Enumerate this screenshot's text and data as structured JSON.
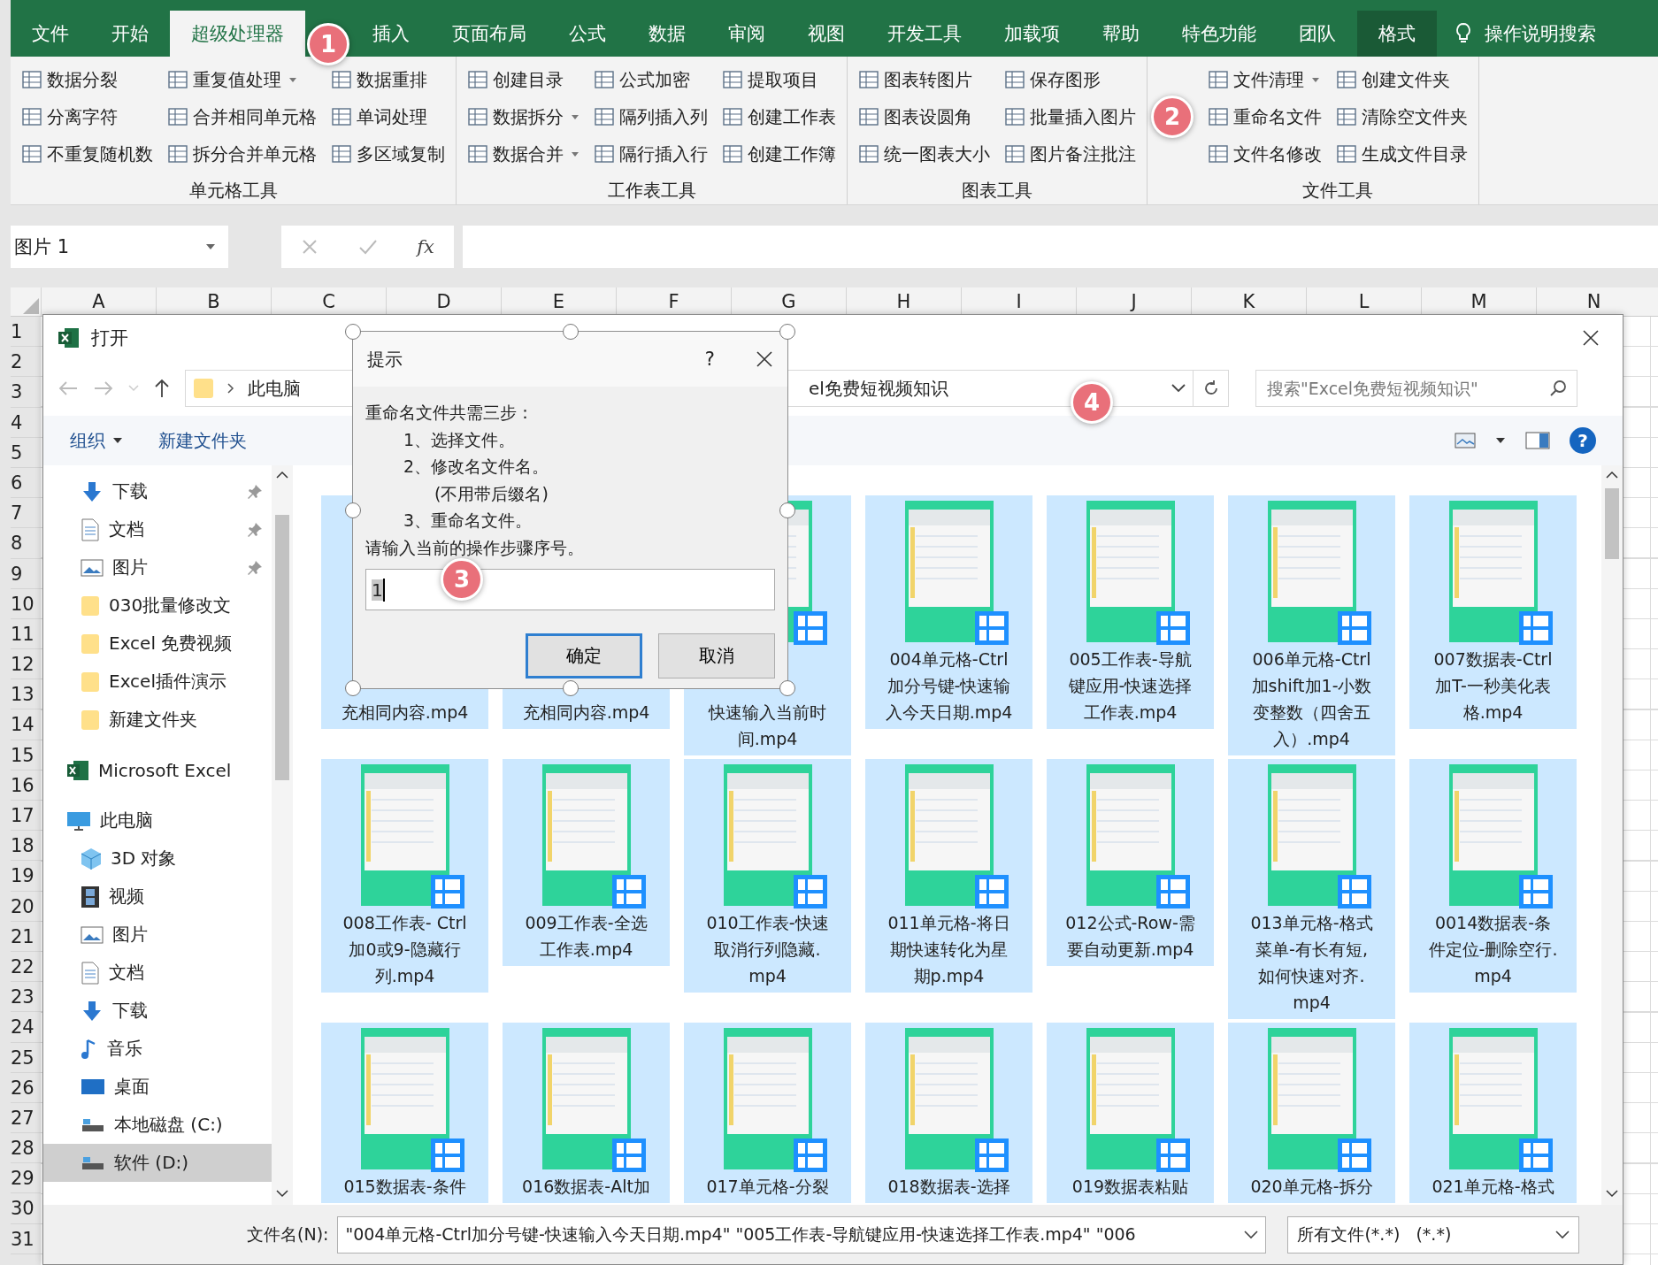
{
  "ribbon": {
    "tabs": [
      {
        "label": "文件",
        "selected": false,
        "kind": "normal"
      },
      {
        "label": "开始",
        "selected": false,
        "kind": "normal"
      },
      {
        "label": "超级处理器",
        "selected": true,
        "kind": "normal"
      },
      {
        "label": "插入",
        "selected": false,
        "kind": "normal"
      },
      {
        "label": "页面布局",
        "selected": false,
        "kind": "normal"
      },
      {
        "label": "公式",
        "selected": false,
        "kind": "normal"
      },
      {
        "label": "数据",
        "selected": false,
        "kind": "normal"
      },
      {
        "label": "审阅",
        "selected": false,
        "kind": "normal"
      },
      {
        "label": "视图",
        "selected": false,
        "kind": "normal"
      },
      {
        "label": "开发工具",
        "selected": false,
        "kind": "normal"
      },
      {
        "label": "加载项",
        "selected": false,
        "kind": "normal"
      },
      {
        "label": "帮助",
        "selected": false,
        "kind": "normal"
      },
      {
        "label": "特色功能",
        "selected": false,
        "kind": "normal"
      },
      {
        "label": "团队",
        "selected": false,
        "kind": "normal"
      },
      {
        "label": "格式",
        "selected": false,
        "kind": "context"
      }
    ],
    "tell_me": "操作说明搜索",
    "groups": [
      {
        "label": "单元格工具",
        "columns": [
          [
            {
              "label": "数据分裂",
              "dropdown": false
            },
            {
              "label": "分离字符",
              "dropdown": false
            },
            {
              "label": "不重复随机数",
              "dropdown": false
            }
          ],
          [
            {
              "label": "重复值处理",
              "dropdown": true
            },
            {
              "label": "合并相同单元格",
              "dropdown": false
            },
            {
              "label": "拆分合并单元格",
              "dropdown": false
            }
          ],
          [
            {
              "label": "数据重排",
              "dropdown": false
            },
            {
              "label": "单词处理",
              "dropdown": false
            },
            {
              "label": "多区域复制",
              "dropdown": false
            }
          ]
        ]
      },
      {
        "label": "工作表工具",
        "columns": [
          [
            {
              "label": "创建目录",
              "dropdown": false
            },
            {
              "label": "数据拆分",
              "dropdown": true
            },
            {
              "label": "数据合并",
              "dropdown": true
            }
          ],
          [
            {
              "label": "公式加密",
              "dropdown": false
            },
            {
              "label": "隔列插入列",
              "dropdown": false
            },
            {
              "label": "隔行插入行",
              "dropdown": false
            }
          ],
          [
            {
              "label": "提取项目",
              "dropdown": false
            },
            {
              "label": "创建工作表",
              "dropdown": false
            },
            {
              "label": "创建工作簿",
              "dropdown": false
            }
          ]
        ]
      },
      {
        "label": "图表工具",
        "columns": [
          [
            {
              "label": "图表转图片",
              "dropdown": false
            },
            {
              "label": "图表设圆角",
              "dropdown": false
            },
            {
              "label": "统一图表大小",
              "dropdown": false
            }
          ],
          [
            {
              "label": "保存图形",
              "dropdown": false
            },
            {
              "label": "批量插入图片",
              "dropdown": false
            },
            {
              "label": "图片备注批注",
              "dropdown": false
            }
          ]
        ]
      },
      {
        "label": "文件工具",
        "columns": [
          [
            {
              "label": "文件清理",
              "dropdown": true
            },
            {
              "label": "重命名文件",
              "dropdown": false
            },
            {
              "label": "文件名修改",
              "dropdown": false
            }
          ],
          [
            {
              "label": "创建文件夹",
              "dropdown": false
            },
            {
              "label": "清除空文件夹",
              "dropdown": false
            },
            {
              "label": "生成文件目录",
              "dropdown": false
            }
          ]
        ]
      }
    ]
  },
  "formula_bar": {
    "name_box": "图片 1",
    "function_label": "fx"
  },
  "sheet": {
    "columns": [
      "A",
      "B",
      "C",
      "D",
      "E",
      "F",
      "G",
      "H",
      "I",
      "J",
      "K",
      "L",
      "M",
      "N"
    ],
    "rows": [
      "1",
      "2",
      "3",
      "4",
      "5",
      "6",
      "7",
      "8",
      "9",
      "10",
      "11",
      "12",
      "13",
      "14",
      "15",
      "16",
      "17",
      "18",
      "19",
      "20",
      "21",
      "22",
      "23",
      "24",
      "25",
      "26",
      "27",
      "28",
      "29",
      "30",
      "31"
    ]
  },
  "open_dialog": {
    "title": "打开",
    "address": [
      "此电脑",
      "el免费短视频知识"
    ],
    "search": {
      "placeholder": "搜索\"Excel免费短视频知识\""
    },
    "organize": "组织",
    "new_folder": "新建文件夹",
    "help_label": "?",
    "quick_access": [
      {
        "label": "下载",
        "kind": "download",
        "pinned": true
      },
      {
        "label": "文档",
        "kind": "document",
        "pinned": true
      },
      {
        "label": "图片",
        "kind": "picture",
        "pinned": true
      },
      {
        "label": "030批量修改文",
        "kind": "folder",
        "pinned": false
      },
      {
        "label": "Excel 免费视频",
        "kind": "folder",
        "pinned": false
      },
      {
        "label": "Excel插件演示",
        "kind": "folder",
        "pinned": false
      },
      {
        "label": "新建文件夹",
        "kind": "folder",
        "pinned": false
      }
    ],
    "tree": [
      {
        "label": "Microsoft Excel",
        "kind": "excel",
        "selected": false
      },
      {
        "label": "此电脑",
        "kind": "pc",
        "selected": false,
        "children": [
          {
            "label": "3D 对象",
            "kind": "cube",
            "selected": false
          },
          {
            "label": "视频",
            "kind": "video",
            "selected": false
          },
          {
            "label": "图片",
            "kind": "picture",
            "selected": false
          },
          {
            "label": "文档",
            "kind": "document",
            "selected": false
          },
          {
            "label": "下载",
            "kind": "download",
            "selected": false
          },
          {
            "label": "音乐",
            "kind": "music",
            "selected": false
          },
          {
            "label": "桌面",
            "kind": "desktop",
            "selected": false
          },
          {
            "label": "本地磁盘 (C:)",
            "kind": "drive",
            "selected": false
          },
          {
            "label": "软件 (D:)",
            "kind": "drive",
            "selected": true
          }
        ]
      }
    ],
    "files": [
      {
        "lines": [
          "充相同内容.mp4"
        ],
        "selected": true,
        "covered": true
      },
      {
        "lines": [
          "充相同内容.mp4"
        ],
        "selected": true,
        "covered": true
      },
      {
        "lines": [
          "快速输入当前时",
          "间.mp4"
        ],
        "selected": true,
        "covered": true
      },
      {
        "lines": [
          "004单元格-Ctrl",
          "加分号键-快速输",
          "入今天日期.mp4"
        ],
        "selected": true,
        "covered": false
      },
      {
        "lines": [
          "005工作表-导航",
          "键应用-快速选择",
          "工作表.mp4"
        ],
        "selected": true,
        "covered": false
      },
      {
        "lines": [
          "006单元格-Ctrl",
          "加shift加1-小数",
          "变整数（四舍五",
          "入）.mp4"
        ],
        "selected": true,
        "covered": false
      },
      {
        "lines": [
          "007数据表-Ctrl",
          "加T-一秒美化表",
          "格.mp4"
        ],
        "selected": true,
        "covered": false
      },
      {
        "lines": [
          "008工作表- Ctrl",
          "加0或9-隐藏行",
          "列.mp4"
        ],
        "selected": true,
        "covered": false
      },
      {
        "lines": [
          "009工作表-全选",
          "工作表.mp4"
        ],
        "selected": true,
        "covered": false
      },
      {
        "lines": [
          "010工作表-快速",
          "取消行列隐藏.",
          "mp4"
        ],
        "selected": true,
        "covered": false
      },
      {
        "lines": [
          "011单元格-将日",
          "期快速转化为星",
          "期p.mp4"
        ],
        "selected": true,
        "covered": false
      },
      {
        "lines": [
          "012公式-Row-需",
          "要自动更新.mp4"
        ],
        "selected": true,
        "covered": false
      },
      {
        "lines": [
          "013单元格-格式",
          "菜单-有长有短,",
          "如何快速对齐.",
          "mp4"
        ],
        "selected": true,
        "covered": false
      },
      {
        "lines": [
          "0014数据表-条",
          "件定位-删除空行.",
          "mp4"
        ],
        "selected": true,
        "covered": false
      },
      {
        "lines": [
          "015数据表-条件"
        ],
        "selected": true,
        "covered": false
      },
      {
        "lines": [
          "016数据表-Alt加"
        ],
        "selected": true,
        "covered": false
      },
      {
        "lines": [
          "017单元格-分裂"
        ],
        "selected": true,
        "covered": false
      },
      {
        "lines": [
          "018数据表-选择"
        ],
        "selected": true,
        "covered": false
      },
      {
        "lines": [
          "019数据表粘贴"
        ],
        "selected": true,
        "covered": false
      },
      {
        "lines": [
          "020单元格-拆分"
        ],
        "selected": true,
        "covered": false
      },
      {
        "lines": [
          "021单元格-格式"
        ],
        "selected": true,
        "covered": false
      }
    ],
    "file_name": {
      "label": "文件名(N):",
      "value": "\"004单元格-Ctrl加分号键-快速输入今天日期.mp4\" \"005工作表-导航键应用-快速选择工作表.mp4\" \"006"
    },
    "file_type": "所有文件(*.*)   (*.*)"
  },
  "prompt_dialog": {
    "title": "提示",
    "help": "?",
    "message": [
      {
        "text": "重命名文件共需三步：",
        "kind": "heading"
      },
      {
        "text": "1、选择文件。",
        "kind": "step"
      },
      {
        "text": "2、修改名文件名。",
        "kind": "step"
      },
      {
        "text": "(不用带后缀名)",
        "kind": "note"
      },
      {
        "text": "3、重命名文件。",
        "kind": "step"
      },
      {
        "text": "请输入当前的操作步骤序号。",
        "kind": "heading"
      }
    ],
    "input_value": "1",
    "buttons": [
      {
        "label": "确定",
        "default": true
      },
      {
        "label": "取消",
        "default": false
      }
    ]
  },
  "callouts": [
    "1",
    "2",
    "3",
    "4"
  ]
}
